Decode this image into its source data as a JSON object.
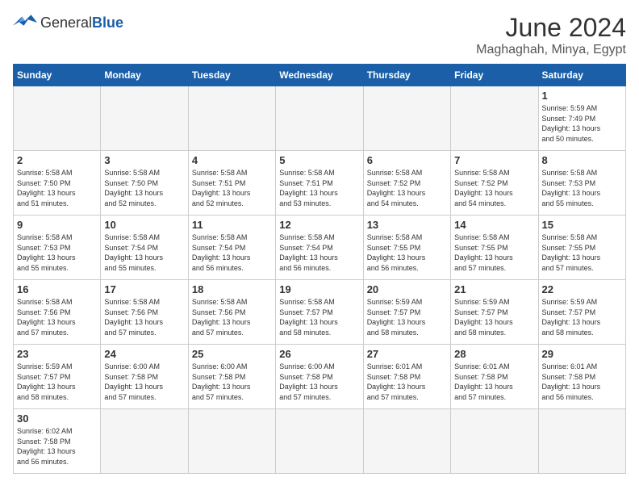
{
  "header": {
    "logo_general": "General",
    "logo_blue": "Blue",
    "month_year": "June 2024",
    "location": "Maghaghah, Minya, Egypt"
  },
  "days_of_week": [
    "Sunday",
    "Monday",
    "Tuesday",
    "Wednesday",
    "Thursday",
    "Friday",
    "Saturday"
  ],
  "weeks": [
    [
      {
        "day": "",
        "info": ""
      },
      {
        "day": "",
        "info": ""
      },
      {
        "day": "",
        "info": ""
      },
      {
        "day": "",
        "info": ""
      },
      {
        "day": "",
        "info": ""
      },
      {
        "day": "",
        "info": ""
      },
      {
        "day": "1",
        "info": "Sunrise: 5:59 AM\nSunset: 7:49 PM\nDaylight: 13 hours\nand 50 minutes."
      }
    ],
    [
      {
        "day": "2",
        "info": "Sunrise: 5:58 AM\nSunset: 7:50 PM\nDaylight: 13 hours\nand 51 minutes."
      },
      {
        "day": "3",
        "info": "Sunrise: 5:58 AM\nSunset: 7:50 PM\nDaylight: 13 hours\nand 52 minutes."
      },
      {
        "day": "4",
        "info": "Sunrise: 5:58 AM\nSunset: 7:51 PM\nDaylight: 13 hours\nand 52 minutes."
      },
      {
        "day": "5",
        "info": "Sunrise: 5:58 AM\nSunset: 7:51 PM\nDaylight: 13 hours\nand 53 minutes."
      },
      {
        "day": "6",
        "info": "Sunrise: 5:58 AM\nSunset: 7:52 PM\nDaylight: 13 hours\nand 54 minutes."
      },
      {
        "day": "7",
        "info": "Sunrise: 5:58 AM\nSunset: 7:52 PM\nDaylight: 13 hours\nand 54 minutes."
      },
      {
        "day": "8",
        "info": "Sunrise: 5:58 AM\nSunset: 7:53 PM\nDaylight: 13 hours\nand 55 minutes."
      }
    ],
    [
      {
        "day": "9",
        "info": "Sunrise: 5:58 AM\nSunset: 7:53 PM\nDaylight: 13 hours\nand 55 minutes."
      },
      {
        "day": "10",
        "info": "Sunrise: 5:58 AM\nSunset: 7:54 PM\nDaylight: 13 hours\nand 55 minutes."
      },
      {
        "day": "11",
        "info": "Sunrise: 5:58 AM\nSunset: 7:54 PM\nDaylight: 13 hours\nand 56 minutes."
      },
      {
        "day": "12",
        "info": "Sunrise: 5:58 AM\nSunset: 7:54 PM\nDaylight: 13 hours\nand 56 minutes."
      },
      {
        "day": "13",
        "info": "Sunrise: 5:58 AM\nSunset: 7:55 PM\nDaylight: 13 hours\nand 56 minutes."
      },
      {
        "day": "14",
        "info": "Sunrise: 5:58 AM\nSunset: 7:55 PM\nDaylight: 13 hours\nand 57 minutes."
      },
      {
        "day": "15",
        "info": "Sunrise: 5:58 AM\nSunset: 7:55 PM\nDaylight: 13 hours\nand 57 minutes."
      }
    ],
    [
      {
        "day": "16",
        "info": "Sunrise: 5:58 AM\nSunset: 7:56 PM\nDaylight: 13 hours\nand 57 minutes."
      },
      {
        "day": "17",
        "info": "Sunrise: 5:58 AM\nSunset: 7:56 PM\nDaylight: 13 hours\nand 57 minutes."
      },
      {
        "day": "18",
        "info": "Sunrise: 5:58 AM\nSunset: 7:56 PM\nDaylight: 13 hours\nand 57 minutes."
      },
      {
        "day": "19",
        "info": "Sunrise: 5:58 AM\nSunset: 7:57 PM\nDaylight: 13 hours\nand 58 minutes."
      },
      {
        "day": "20",
        "info": "Sunrise: 5:59 AM\nSunset: 7:57 PM\nDaylight: 13 hours\nand 58 minutes."
      },
      {
        "day": "21",
        "info": "Sunrise: 5:59 AM\nSunset: 7:57 PM\nDaylight: 13 hours\nand 58 minutes."
      },
      {
        "day": "22",
        "info": "Sunrise: 5:59 AM\nSunset: 7:57 PM\nDaylight: 13 hours\nand 58 minutes."
      }
    ],
    [
      {
        "day": "23",
        "info": "Sunrise: 5:59 AM\nSunset: 7:57 PM\nDaylight: 13 hours\nand 58 minutes."
      },
      {
        "day": "24",
        "info": "Sunrise: 6:00 AM\nSunset: 7:58 PM\nDaylight: 13 hours\nand 57 minutes."
      },
      {
        "day": "25",
        "info": "Sunrise: 6:00 AM\nSunset: 7:58 PM\nDaylight: 13 hours\nand 57 minutes."
      },
      {
        "day": "26",
        "info": "Sunrise: 6:00 AM\nSunset: 7:58 PM\nDaylight: 13 hours\nand 57 minutes."
      },
      {
        "day": "27",
        "info": "Sunrise: 6:01 AM\nSunset: 7:58 PM\nDaylight: 13 hours\nand 57 minutes."
      },
      {
        "day": "28",
        "info": "Sunrise: 6:01 AM\nSunset: 7:58 PM\nDaylight: 13 hours\nand 57 minutes."
      },
      {
        "day": "29",
        "info": "Sunrise: 6:01 AM\nSunset: 7:58 PM\nDaylight: 13 hours\nand 56 minutes."
      }
    ],
    [
      {
        "day": "30",
        "info": "Sunrise: 6:02 AM\nSunset: 7:58 PM\nDaylight: 13 hours\nand 56 minutes."
      },
      {
        "day": "",
        "info": ""
      },
      {
        "day": "",
        "info": ""
      },
      {
        "day": "",
        "info": ""
      },
      {
        "day": "",
        "info": ""
      },
      {
        "day": "",
        "info": ""
      },
      {
        "day": "",
        "info": ""
      }
    ]
  ]
}
